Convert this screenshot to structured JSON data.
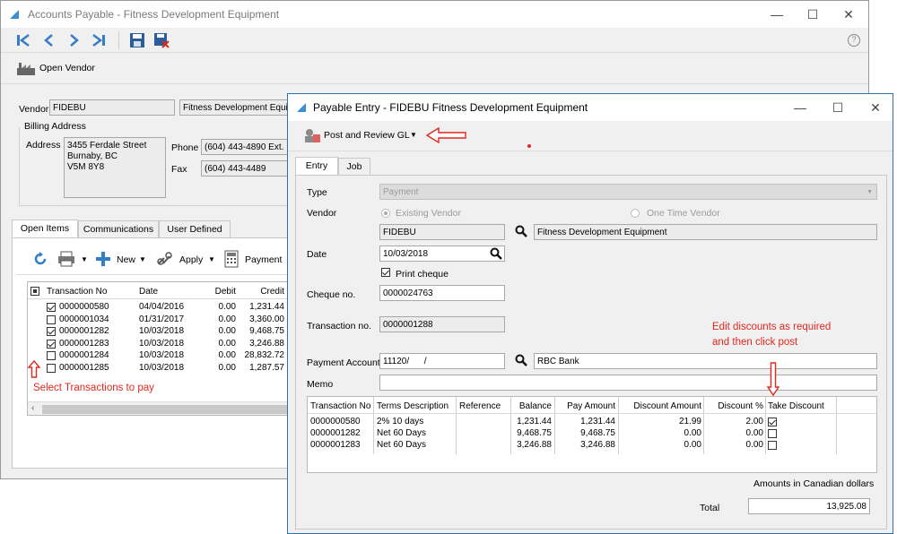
{
  "back_window": {
    "title": "Accounts Payable - Fitness Development Equipment",
    "help_label": "?",
    "open_vendor_label": "Open Vendor",
    "vendor_label": "Vendor",
    "vendor_code": "FIDEBU",
    "vendor_name": "Fitness Development Equip",
    "billing_address_label": "Billing Address",
    "address_label": "Address",
    "address_lines": [
      "3455 Ferdale Street",
      "Burnaby, BC",
      "V5M 8Y8"
    ],
    "phone_label": "Phone",
    "phone_value": "(604) 443-4890 Ext.",
    "fax_label": "Fax",
    "fax_value": "(604) 443-4489",
    "tabs": [
      "Open Items",
      "Communications",
      "User Defined"
    ],
    "toolbar": {
      "new_label": "New",
      "apply_label": "Apply",
      "payment_label": "Payment"
    },
    "columns": [
      "Transaction No",
      "Date",
      "Debit",
      "Credit"
    ],
    "rows": [
      {
        "checked": true,
        "txn": "0000000580",
        "date": "04/04/2016",
        "debit": "0.00",
        "credit": "1,231.44"
      },
      {
        "checked": false,
        "txn": "0000001034",
        "date": "01/31/2017",
        "debit": "0.00",
        "credit": "3,360.00"
      },
      {
        "checked": true,
        "txn": "0000001282",
        "date": "10/03/2018",
        "debit": "0.00",
        "credit": "9,468.75"
      },
      {
        "checked": true,
        "txn": "0000001283",
        "date": "10/03/2018",
        "debit": "0.00",
        "credit": "3,246.88"
      },
      {
        "checked": false,
        "txn": "0000001284",
        "date": "10/03/2018",
        "debit": "0.00",
        "credit": "28,832.72"
      },
      {
        "checked": false,
        "txn": "0000001285",
        "date": "10/03/2018",
        "debit": "0.00",
        "credit": "1,287.57"
      }
    ],
    "annotation": "Select Transactions to pay"
  },
  "front_window": {
    "title": "Payable Entry - FIDEBU Fitness Development Equipment",
    "post_label": "Post and Review GL",
    "tabs": [
      "Entry",
      "Job"
    ],
    "type_label": "Type",
    "type_value": "Payment",
    "vendor_label": "Vendor",
    "existing_vendor_label": "Existing Vendor",
    "one_time_vendor_label": "One Time Vendor",
    "vendor_code": "FIDEBU",
    "vendor_name": "Fitness Development Equipment",
    "date_label": "Date",
    "date_value": "10/03/2018",
    "print_cheque_label": "Print cheque",
    "cheque_label": "Cheque no.",
    "cheque_value": "0000024763",
    "transaction_label": "Transaction no.",
    "transaction_value": "0000001288",
    "payment_account_label": "Payment Account",
    "payment_account_value": "11120/      /",
    "payment_account_name": "RBC Bank",
    "memo_label": "Memo",
    "memo_value": "",
    "columns": [
      "Transaction No",
      "Terms Description",
      "Reference",
      "Balance",
      "Pay Amount",
      "Discount Amount",
      "Discount %",
      "Take Discount"
    ],
    "rows": [
      {
        "txn": "0000000580",
        "terms": "2% 10 days",
        "reference": "",
        "balance": "1,231.44",
        "pay": "1,231.44",
        "discount_amount": "21.99",
        "discount_pct": "2.00",
        "take": true
      },
      {
        "txn": "0000001282",
        "terms": "Net 60 Days",
        "reference": "",
        "balance": "9,468.75",
        "pay": "9,468.75",
        "discount_amount": "0.00",
        "discount_pct": "0.00",
        "take": false
      },
      {
        "txn": "0000001283",
        "terms": "Net 60 Days",
        "reference": "",
        "balance": "3,246.88",
        "pay": "3,246.88",
        "discount_amount": "0.00",
        "discount_pct": "0.00",
        "take": false
      }
    ],
    "amounts_note": "Amounts in Canadian dollars",
    "total_label": "Total",
    "total_value": "13,925.08",
    "annotation_lines": [
      "Edit discounts as required",
      "and then click post"
    ]
  },
  "colors": {
    "accent": "#2f6fb3",
    "annotation": "#e0281e",
    "disabled_text": "#9a9a9a"
  }
}
